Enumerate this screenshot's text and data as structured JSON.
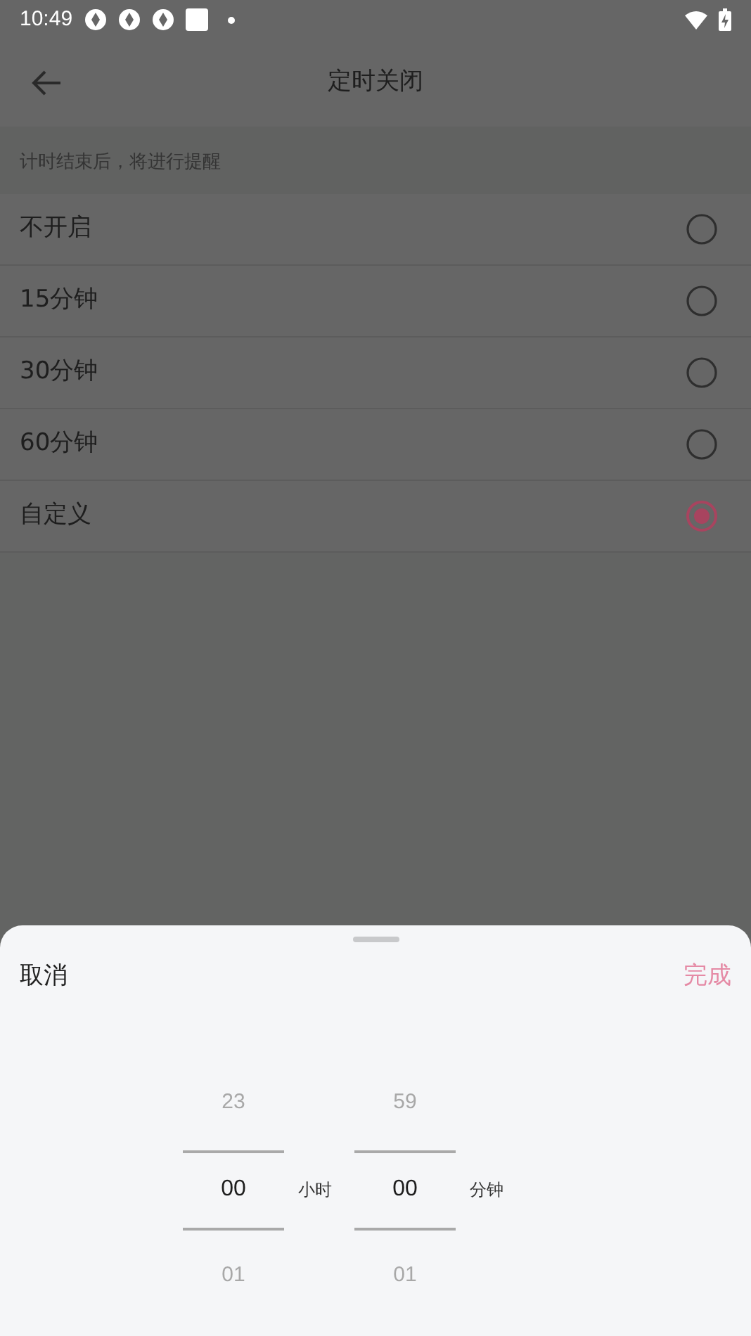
{
  "status_bar": {
    "time": "10:49"
  },
  "app_bar": {
    "title": "定时关闭"
  },
  "section": {
    "hint": "计时结束后，将进行提醒"
  },
  "options": [
    {
      "label": "不开启",
      "selected": false
    },
    {
      "label": "15分钟",
      "selected": false
    },
    {
      "label": "30分钟",
      "selected": false
    },
    {
      "label": "60分钟",
      "selected": false
    },
    {
      "label": "自定义",
      "selected": true
    }
  ],
  "sheet": {
    "cancel": "取消",
    "confirm": "完成",
    "confirm_disabled": true,
    "wheels": [
      {
        "above": "23",
        "value": "00",
        "below": "01",
        "unit": "小时"
      },
      {
        "above": "59",
        "value": "00",
        "below": "01",
        "unit": "分钟"
      }
    ]
  }
}
